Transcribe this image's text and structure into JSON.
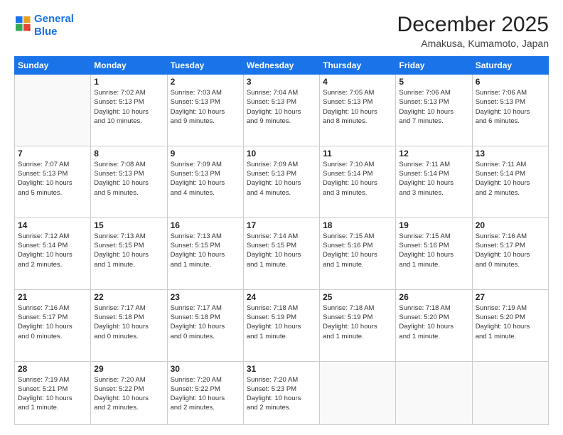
{
  "header": {
    "logo_line1": "General",
    "logo_line2": "Blue",
    "month": "December 2025",
    "location": "Amakusa, Kumamoto, Japan"
  },
  "days_of_week": [
    "Sunday",
    "Monday",
    "Tuesday",
    "Wednesday",
    "Thursday",
    "Friday",
    "Saturday"
  ],
  "weeks": [
    [
      {
        "day": "",
        "info": ""
      },
      {
        "day": "1",
        "info": "Sunrise: 7:02 AM\nSunset: 5:13 PM\nDaylight: 10 hours\nand 10 minutes."
      },
      {
        "day": "2",
        "info": "Sunrise: 7:03 AM\nSunset: 5:13 PM\nDaylight: 10 hours\nand 9 minutes."
      },
      {
        "day": "3",
        "info": "Sunrise: 7:04 AM\nSunset: 5:13 PM\nDaylight: 10 hours\nand 9 minutes."
      },
      {
        "day": "4",
        "info": "Sunrise: 7:05 AM\nSunset: 5:13 PM\nDaylight: 10 hours\nand 8 minutes."
      },
      {
        "day": "5",
        "info": "Sunrise: 7:06 AM\nSunset: 5:13 PM\nDaylight: 10 hours\nand 7 minutes."
      },
      {
        "day": "6",
        "info": "Sunrise: 7:06 AM\nSunset: 5:13 PM\nDaylight: 10 hours\nand 6 minutes."
      }
    ],
    [
      {
        "day": "7",
        "info": "Sunrise: 7:07 AM\nSunset: 5:13 PM\nDaylight: 10 hours\nand 5 minutes."
      },
      {
        "day": "8",
        "info": "Sunrise: 7:08 AM\nSunset: 5:13 PM\nDaylight: 10 hours\nand 5 minutes."
      },
      {
        "day": "9",
        "info": "Sunrise: 7:09 AM\nSunset: 5:13 PM\nDaylight: 10 hours\nand 4 minutes."
      },
      {
        "day": "10",
        "info": "Sunrise: 7:09 AM\nSunset: 5:13 PM\nDaylight: 10 hours\nand 4 minutes."
      },
      {
        "day": "11",
        "info": "Sunrise: 7:10 AM\nSunset: 5:14 PM\nDaylight: 10 hours\nand 3 minutes."
      },
      {
        "day": "12",
        "info": "Sunrise: 7:11 AM\nSunset: 5:14 PM\nDaylight: 10 hours\nand 3 minutes."
      },
      {
        "day": "13",
        "info": "Sunrise: 7:11 AM\nSunset: 5:14 PM\nDaylight: 10 hours\nand 2 minutes."
      }
    ],
    [
      {
        "day": "14",
        "info": "Sunrise: 7:12 AM\nSunset: 5:14 PM\nDaylight: 10 hours\nand 2 minutes."
      },
      {
        "day": "15",
        "info": "Sunrise: 7:13 AM\nSunset: 5:15 PM\nDaylight: 10 hours\nand 1 minute."
      },
      {
        "day": "16",
        "info": "Sunrise: 7:13 AM\nSunset: 5:15 PM\nDaylight: 10 hours\nand 1 minute."
      },
      {
        "day": "17",
        "info": "Sunrise: 7:14 AM\nSunset: 5:15 PM\nDaylight: 10 hours\nand 1 minute."
      },
      {
        "day": "18",
        "info": "Sunrise: 7:15 AM\nSunset: 5:16 PM\nDaylight: 10 hours\nand 1 minute."
      },
      {
        "day": "19",
        "info": "Sunrise: 7:15 AM\nSunset: 5:16 PM\nDaylight: 10 hours\nand 1 minute."
      },
      {
        "day": "20",
        "info": "Sunrise: 7:16 AM\nSunset: 5:17 PM\nDaylight: 10 hours\nand 0 minutes."
      }
    ],
    [
      {
        "day": "21",
        "info": "Sunrise: 7:16 AM\nSunset: 5:17 PM\nDaylight: 10 hours\nand 0 minutes."
      },
      {
        "day": "22",
        "info": "Sunrise: 7:17 AM\nSunset: 5:18 PM\nDaylight: 10 hours\nand 0 minutes."
      },
      {
        "day": "23",
        "info": "Sunrise: 7:17 AM\nSunset: 5:18 PM\nDaylight: 10 hours\nand 0 minutes."
      },
      {
        "day": "24",
        "info": "Sunrise: 7:18 AM\nSunset: 5:19 PM\nDaylight: 10 hours\nand 1 minute."
      },
      {
        "day": "25",
        "info": "Sunrise: 7:18 AM\nSunset: 5:19 PM\nDaylight: 10 hours\nand 1 minute."
      },
      {
        "day": "26",
        "info": "Sunrise: 7:18 AM\nSunset: 5:20 PM\nDaylight: 10 hours\nand 1 minute."
      },
      {
        "day": "27",
        "info": "Sunrise: 7:19 AM\nSunset: 5:20 PM\nDaylight: 10 hours\nand 1 minute."
      }
    ],
    [
      {
        "day": "28",
        "info": "Sunrise: 7:19 AM\nSunset: 5:21 PM\nDaylight: 10 hours\nand 1 minute."
      },
      {
        "day": "29",
        "info": "Sunrise: 7:20 AM\nSunset: 5:22 PM\nDaylight: 10 hours\nand 2 minutes."
      },
      {
        "day": "30",
        "info": "Sunrise: 7:20 AM\nSunset: 5:22 PM\nDaylight: 10 hours\nand 2 minutes."
      },
      {
        "day": "31",
        "info": "Sunrise: 7:20 AM\nSunset: 5:23 PM\nDaylight: 10 hours\nand 2 minutes."
      },
      {
        "day": "",
        "info": ""
      },
      {
        "day": "",
        "info": ""
      },
      {
        "day": "",
        "info": ""
      }
    ]
  ]
}
